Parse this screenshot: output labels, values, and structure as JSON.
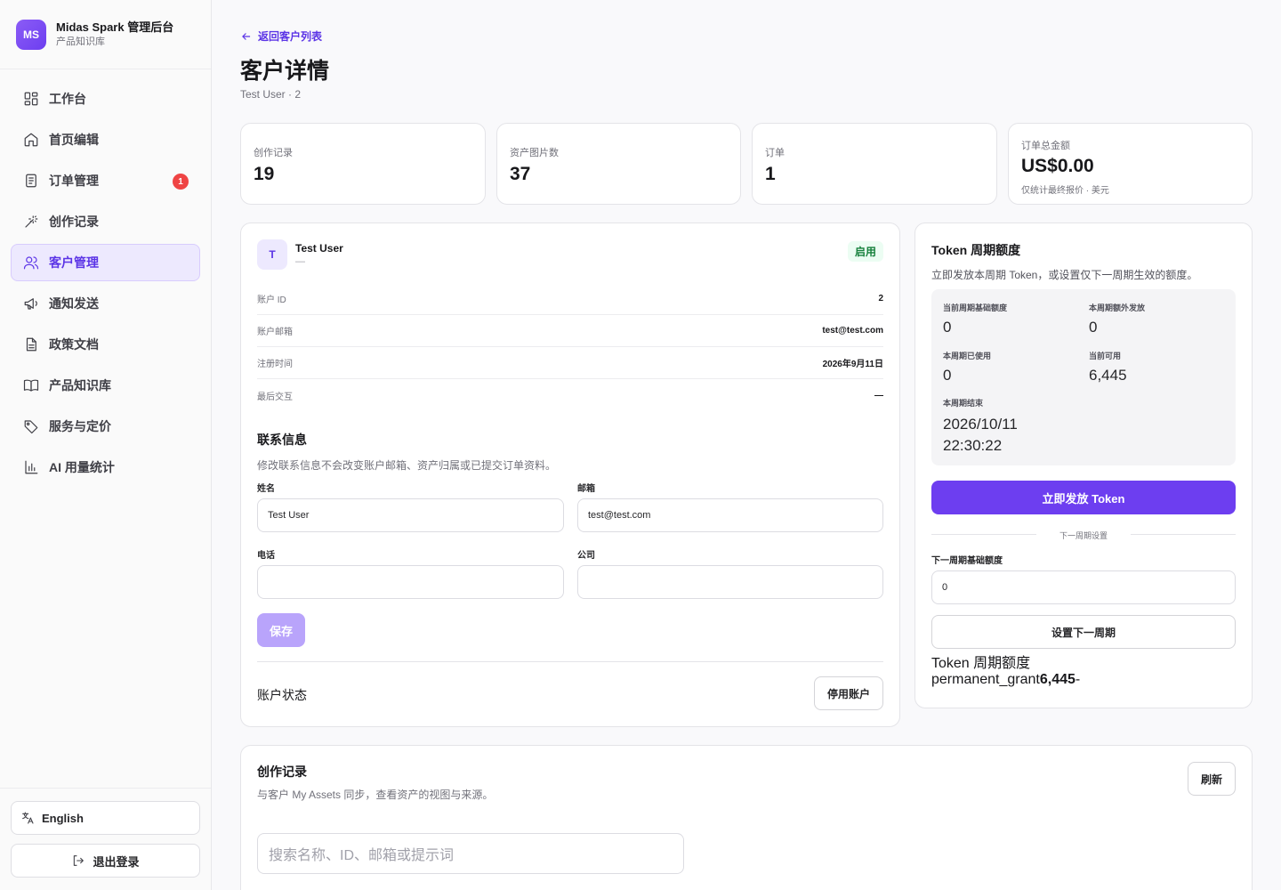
{
  "brand": {
    "logo_text": "MS",
    "name": "Midas Spark 管理后台",
    "sub": "产品知识库"
  },
  "nav": [
    {
      "label": "工作台",
      "icon": "dashboard-icon"
    },
    {
      "label": "首页编辑",
      "icon": "home-icon"
    },
    {
      "label": "订单管理",
      "icon": "order-icon",
      "badge": "1"
    },
    {
      "label": "创作记录",
      "icon": "magic-wand-icon"
    },
    {
      "label": "客户管理",
      "icon": "users-icon",
      "active": true
    },
    {
      "label": "通知发送",
      "icon": "megaphone-icon"
    },
    {
      "label": "政策文档",
      "icon": "document-icon"
    },
    {
      "label": "产品知识库",
      "icon": "book-icon"
    },
    {
      "label": "服务与定价",
      "icon": "tag-icon"
    },
    {
      "label": "AI 用量统计",
      "icon": "bar-chart-icon"
    }
  ],
  "footer": {
    "language": "English",
    "logout": "退出登录"
  },
  "header": {
    "back": "返回客户列表",
    "title": "客户详情",
    "subtitle": "Test User · 2"
  },
  "stats": [
    {
      "label": "创作记录",
      "value": "19"
    },
    {
      "label": "资产图片数",
      "value": "37"
    },
    {
      "label": "订单",
      "value": "1"
    },
    {
      "label": "订单总金额",
      "value": "US$0.00",
      "note": "仅统计最终报价 · 美元"
    }
  ],
  "customer": {
    "avatar": "T",
    "name": "Test User",
    "dash": "—",
    "status": "启用",
    "info": [
      {
        "label": "账户 ID",
        "value": "2"
      },
      {
        "label": "账户邮箱",
        "value": "test@test.com"
      },
      {
        "label": "注册时间",
        "value": "2026年9月11日"
      },
      {
        "label": "最后交互",
        "value": "—"
      }
    ],
    "contact_title": "联系信息",
    "contact_desc": "修改联系信息不会改变账户邮箱、资产归属或已提交订单资料。",
    "fields": {
      "name_label": "姓名",
      "name_value": "Test User",
      "email_label": "邮箱",
      "email_value": "test@test.com",
      "phone_label": "电话",
      "phone_value": "",
      "company_label": "公司",
      "company_value": ""
    },
    "save": "保存",
    "account_status": "账户状态",
    "disable": "停用账户"
  },
  "token": {
    "title": "Token 周期额度",
    "desc": "立即发放本周期 Token，或设置仅下一周期生效的额度。",
    "base_label": "当前周期基础额度",
    "base_value": "0",
    "extra_label": "本周期额外发放",
    "extra_value": "0",
    "used_label": "本周期已使用",
    "used_value": "0",
    "available_label": "当前可用",
    "available_value": "6,445",
    "end_label": "本周期结束",
    "end_date": "2026/10/11",
    "end_time": "22:30:22",
    "grant_button": "立即发放 Token",
    "next_divider": "下一周期设置",
    "next_label": "下一周期基础额度",
    "next_value": "0",
    "set_next": "设置下一周期",
    "footer_title": "Token 周期额度",
    "footer_key": "permanent_grant",
    "footer_value": "6,445",
    "footer_suffix": "-"
  },
  "records": {
    "title": "创作记录",
    "desc": "与客户 My Assets 同步，查看资产的视图与来源。",
    "refresh": "刷新",
    "search_placeholder": "搜索名称、ID、邮箱或提示词"
  },
  "colors": {
    "accent": "#6d3ef0",
    "accent_light": "#ede9fe",
    "badge": "#ef4444",
    "status_green": "#16803c"
  }
}
